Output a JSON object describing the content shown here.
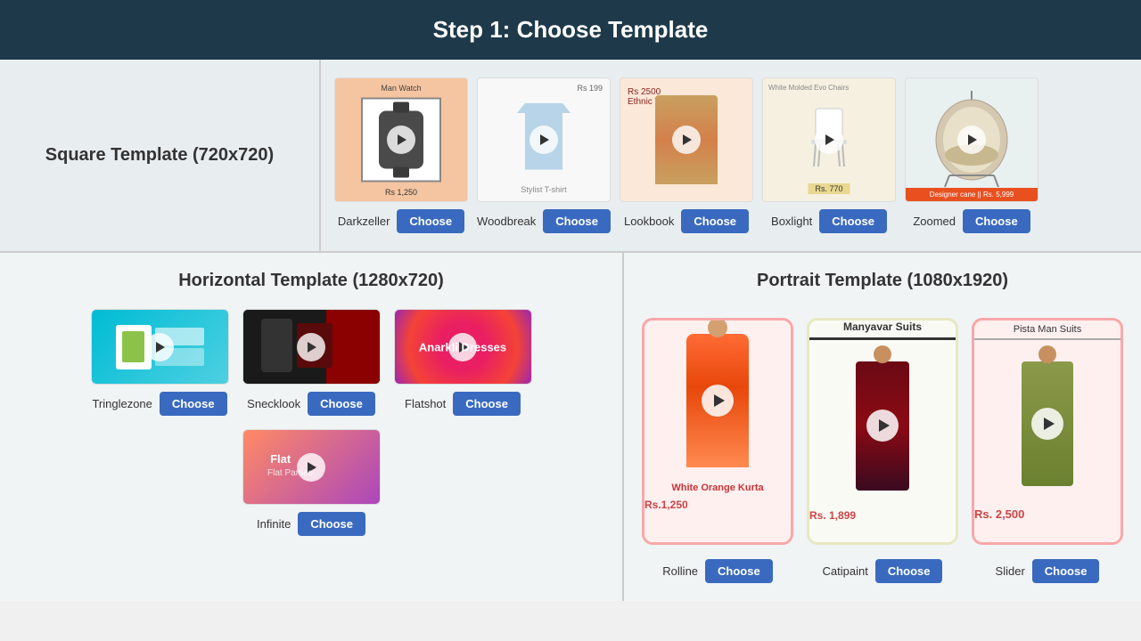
{
  "header": {
    "title": "Step 1: Choose Template"
  },
  "squareSection": {
    "label": "Square Template (720x720)",
    "templates": [
      {
        "id": "darkzeller",
        "name": "Darkzeller",
        "priceTop": "Man Watch",
        "priceBottom": "Rs 1,250"
      },
      {
        "id": "woodbreak",
        "name": "Woodbreak",
        "subLabel": "Stylist T-shirt",
        "priceTop": "Rs 199"
      },
      {
        "id": "lookbook",
        "name": "Lookbook",
        "priceLabel": "Rs 2500",
        "subLabel": "Ethnic Wear"
      },
      {
        "id": "boxlight",
        "name": "Boxlight",
        "title": "White Molded Evo Chairs",
        "price": "Rs. 770"
      },
      {
        "id": "zoomed",
        "name": "Zoomed",
        "bottomLabel": "Designer cane || Rs. 5,999"
      }
    ],
    "chooseLabel": "Choose"
  },
  "horizontalSection": {
    "label": "Horizontal Template (1280x720)",
    "templates": [
      {
        "id": "tringlezone",
        "name": "Tringlezone"
      },
      {
        "id": "snecklook",
        "name": "Snecklook"
      },
      {
        "id": "flatshot",
        "name": "Flatshot",
        "overlayText": "Anarkli Dresses"
      },
      {
        "id": "infinite",
        "name": "Infinite",
        "overlayText": "Flat",
        "subText": "Flat Parties"
      }
    ],
    "chooseLabel": "Choose"
  },
  "portraitSection": {
    "label": "Portrait Template (1080x1920)",
    "templates": [
      {
        "id": "rolline",
        "name": "Rolline",
        "productName": "White Orange Kurta",
        "price": "Rs.1,250"
      },
      {
        "id": "catipaint",
        "name": "Catipaint",
        "productName": "Manyavar Suits",
        "price": "Rs. 1,899"
      },
      {
        "id": "slider",
        "name": "Slider",
        "productName": "Pista Man Suits",
        "price": "Rs. 2,500"
      }
    ],
    "chooseLabel": "Choose"
  }
}
